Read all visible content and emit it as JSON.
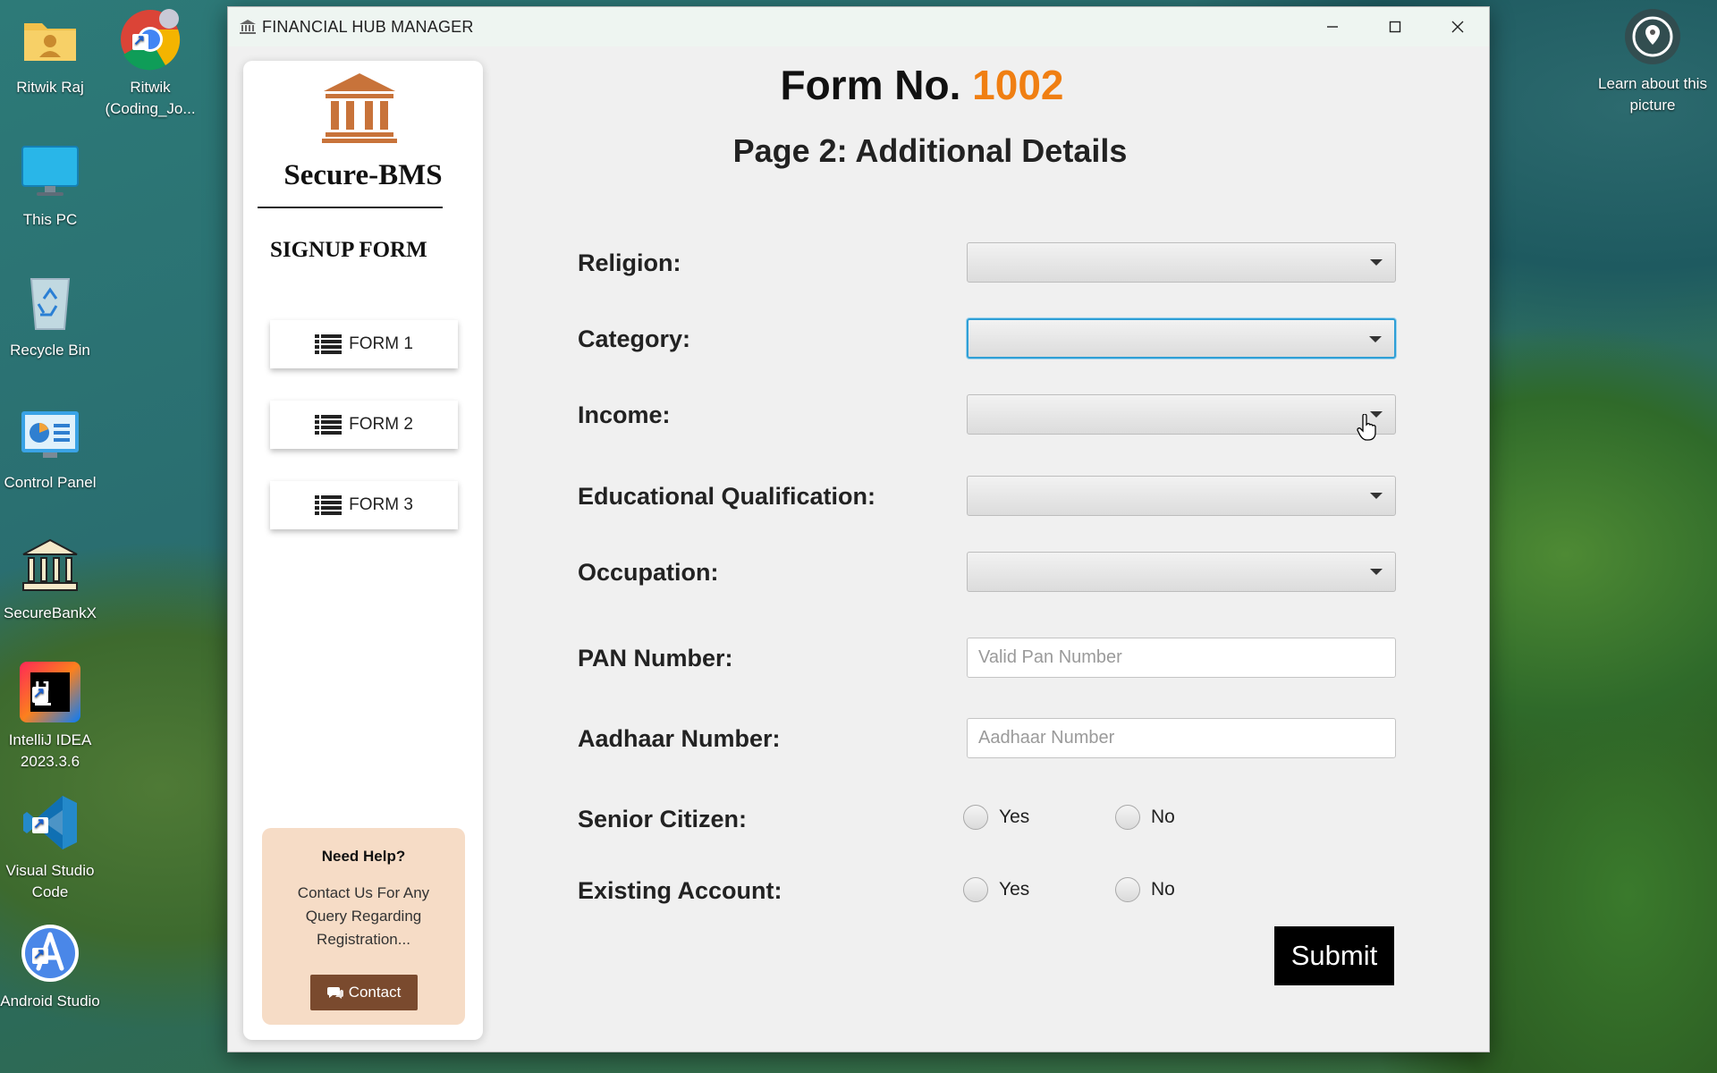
{
  "desktop": {
    "icons": [
      {
        "label": "Ritwik Raj",
        "icon": "user-folder-icon"
      },
      {
        "label": "Ritwik (Coding_Jo...",
        "icon": "chrome-icon"
      },
      {
        "label": "This PC",
        "icon": "monitor-icon"
      },
      {
        "label": "Recycle Bin",
        "icon": "recycle-bin-icon"
      },
      {
        "label": "Control Panel",
        "icon": "control-panel-icon"
      },
      {
        "label": "SecureBankX",
        "icon": "bank-icon"
      },
      {
        "label": "IntelliJ IDEA 2023.3.6",
        "icon": "intellij-icon"
      },
      {
        "label": "Visual Studio Code",
        "icon": "vscode-icon"
      },
      {
        "label": "Android Studio",
        "icon": "android-studio-icon"
      }
    ],
    "learn_label": "Learn about this picture"
  },
  "window": {
    "title": "FINANCIAL HUB MANAGER",
    "icon": "bank-icon"
  },
  "sidebar": {
    "brand": "Secure-BMS",
    "section_title": "SIGNUP FORM",
    "nav": [
      {
        "label": "FORM 1",
        "icon": "list-icon"
      },
      {
        "label": "FORM 2",
        "icon": "list-icon"
      },
      {
        "label": "FORM 3",
        "icon": "list-icon"
      }
    ],
    "help": {
      "title": "Need Help?",
      "text": "Contact Us For Any Query Regarding Registration...",
      "button_label": "Contact",
      "button_icon": "chat-icon"
    }
  },
  "form": {
    "form_no_label": "Form No.",
    "form_no": "1002",
    "page_title": "Page 2: Additional Details",
    "fields": {
      "religion": {
        "label": "Religion:",
        "value": ""
      },
      "category": {
        "label": "Category:",
        "value": ""
      },
      "income": {
        "label": "Income:",
        "value": ""
      },
      "education": {
        "label": "Educational Qualification:",
        "value": ""
      },
      "occupation": {
        "label": "Occupation:",
        "value": ""
      },
      "pan": {
        "label": "PAN Number:",
        "placeholder": "Valid Pan Number",
        "value": ""
      },
      "aadhaar": {
        "label": "Aadhaar Number:",
        "placeholder": "Aadhaar Number",
        "value": ""
      },
      "senior": {
        "label": "Senior Citizen:",
        "yes": "Yes",
        "no": "No"
      },
      "existing": {
        "label": "Existing Account:",
        "yes": "Yes",
        "no": "No"
      }
    },
    "submit_label": "Submit"
  },
  "colors": {
    "form_number": "#f07f12",
    "focus_ring": "#2f9fd6",
    "help_bg": "#f6dcc6",
    "contact_btn": "#7a4a2e",
    "logo": "#c8733a"
  }
}
